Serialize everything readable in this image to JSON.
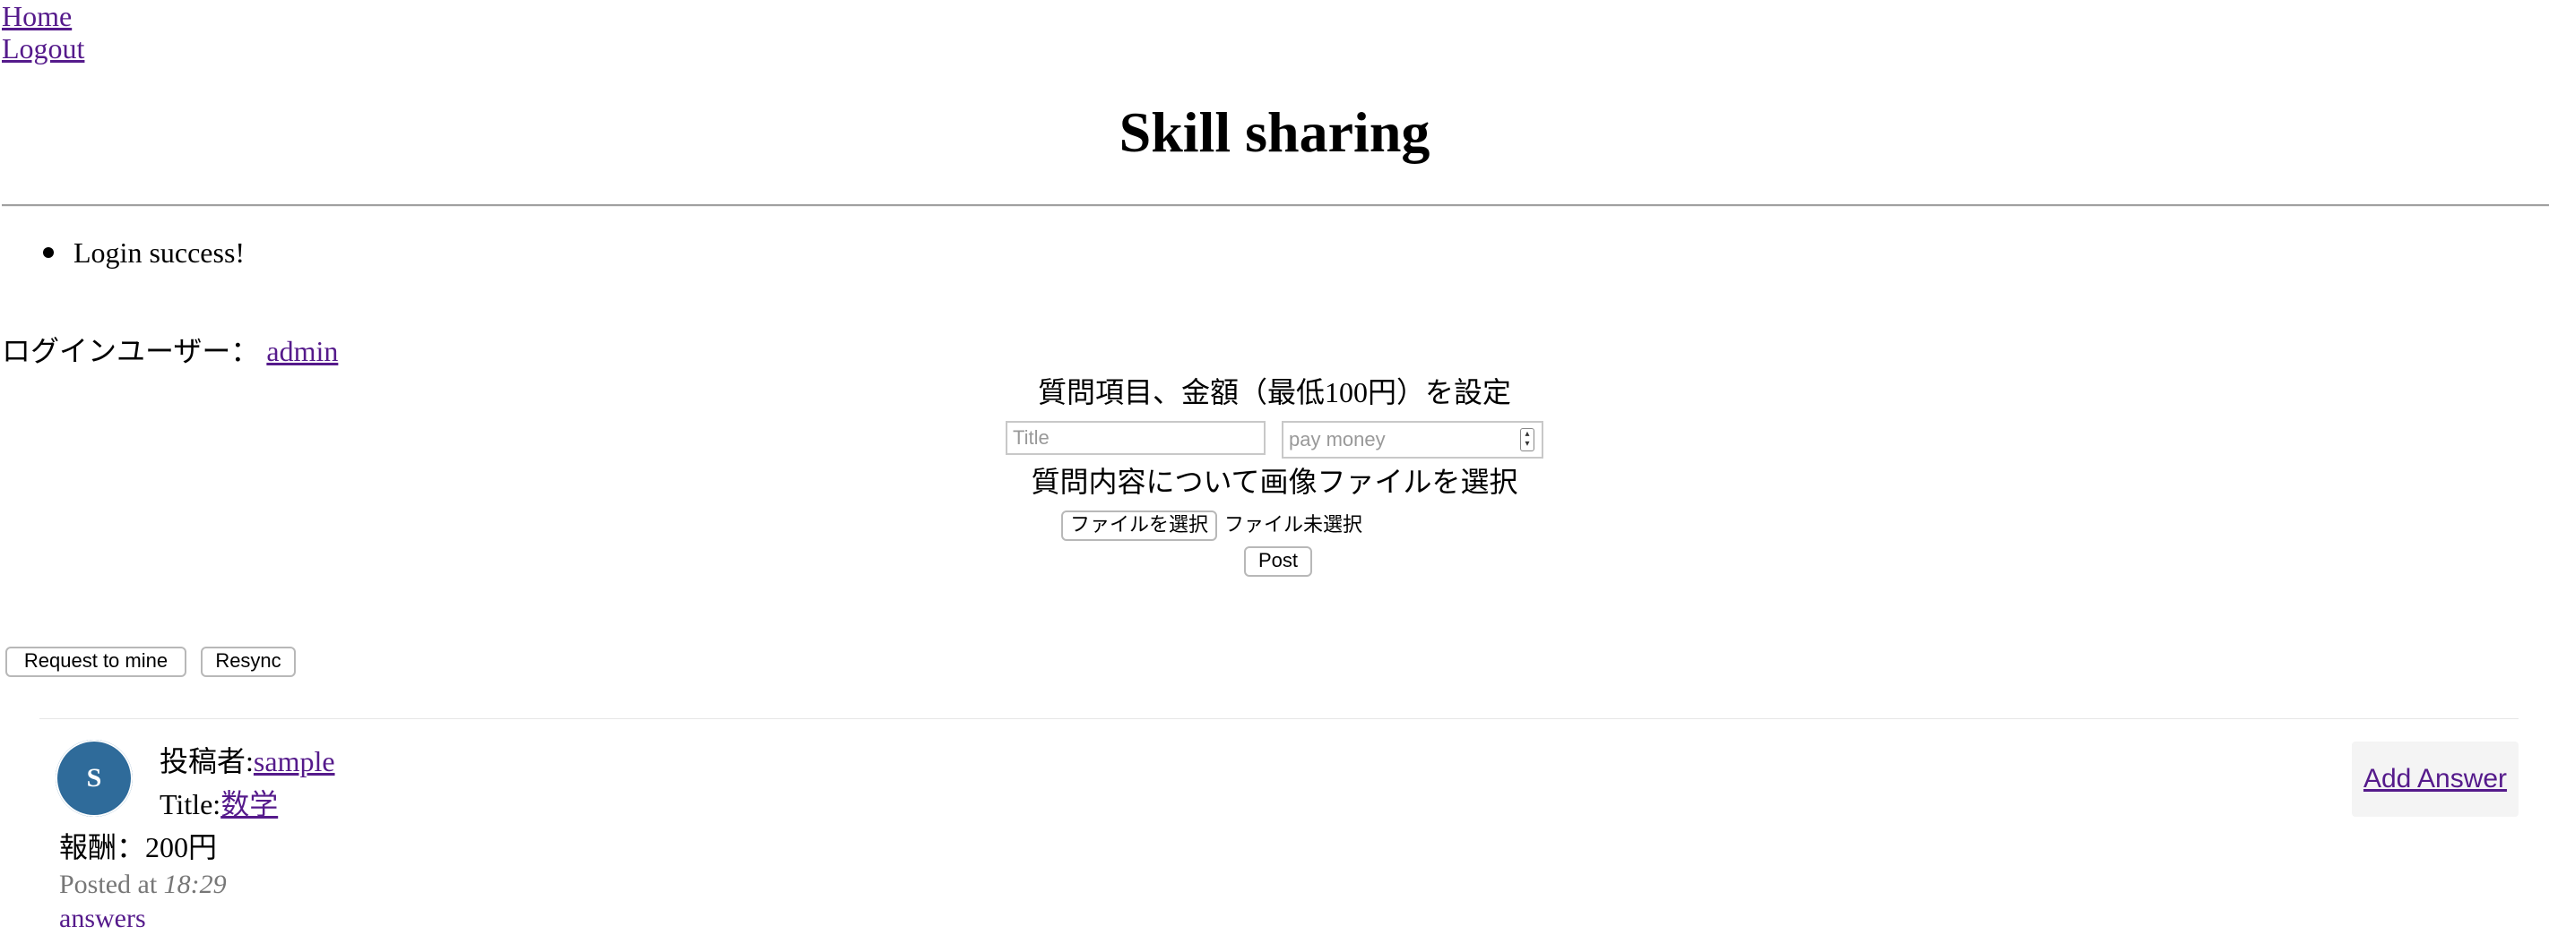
{
  "nav": {
    "home": "Home",
    "logout": "Logout"
  },
  "site_title": "Skill sharing",
  "flash": {
    "message": "Login success!"
  },
  "login": {
    "label": "ログインユーザー：",
    "user": "admin"
  },
  "form": {
    "price_label": "質問項目、金額（最低100円）を設定",
    "title_placeholder": "Title",
    "money_placeholder": "pay money",
    "file_label": "質問内容について画像ファイルを選択",
    "file_button": "ファイルを選択",
    "file_status": "ファイル未選択",
    "post_button": "Post"
  },
  "actions": {
    "request_to_mine": "Request to mine",
    "resync": "Resync"
  },
  "question": {
    "avatar_letter": "S",
    "poster_label": "投稿者:",
    "poster_name": "sample",
    "title_label": "Title:",
    "title_value": "数学",
    "reward": "報酬：200円",
    "posted_prefix": "Posted at",
    "posted_time": "18:29",
    "answers_link": "answers",
    "add_answer": "Add Answer"
  },
  "colors": {
    "link": "#551a8b",
    "avatar": "#2f6b9a",
    "muted": "#777777"
  }
}
